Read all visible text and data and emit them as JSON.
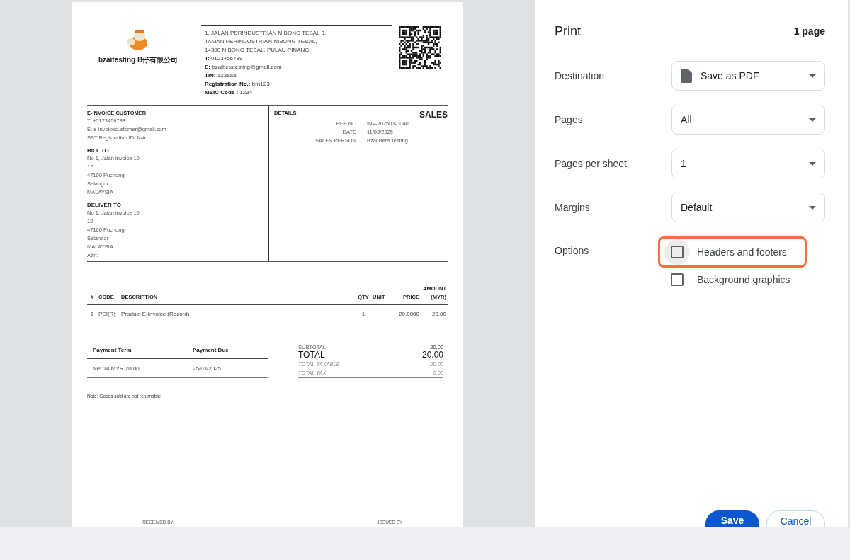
{
  "invoice": {
    "company_name": "bzaitesting B仔有限公司",
    "address_lines": [
      "1, JALAN PERINDUSTRIAN NIBONG TEBAL 3,",
      "TAMAN PERINDUSTRIAN NIBONG TEBAL,",
      "14300 NIBONG TEBAL, PULAU PINANG."
    ],
    "contact_lines": [
      "**T:** 0123456789",
      "**E:** bzaibetatesting@gmail.com",
      "**TIN:** 123aaa",
      "**Registration No.:** brn123",
      "**MSIC Code :** 1234"
    ],
    "customer": {
      "title": "E-INVOICE CUSTOMER",
      "lines": [
        "T: +0123456788",
        "E: e-invoicecustomer@gmail.com",
        "SST Registration ID: N/A"
      ]
    },
    "bill_to": {
      "title": "BILL TO",
      "lines": [
        "No 1, Jalan invoice 10",
        "12",
        "47100 Puchong",
        "Selangor",
        "MALAYSIA"
      ]
    },
    "deliver_to": {
      "title": "DELIVER TO",
      "lines": [
        "No 1, Jalan invoice 10",
        "12",
        "47100 Puchong",
        "Selangor",
        "MALAYSIA",
        "Attn:"
      ]
    },
    "details": {
      "title": "DETAILS",
      "document_type": "SALES",
      "rows": [
        {
          "label": "REF NO",
          "value": "INV-202503-0040"
        },
        {
          "label": "DATE",
          "value": "11/03/2025"
        },
        {
          "label": "SALES PERSON",
          "value": "Bzai Beta Testing"
        }
      ]
    },
    "items": {
      "columns": [
        "#",
        "CODE",
        "DESCRIPTION",
        "QTY",
        "UNIT",
        "PRICE",
        "AMOUNT (MYR)"
      ],
      "rows": [
        {
          "number": "1",
          "code": "PEI(R)",
          "description": "Product E-Invoice (Record)",
          "qty": "1",
          "price": "20.0000",
          "amount": "20.00"
        }
      ]
    },
    "payment": {
      "columns": [
        "Payment Term",
        "Payment Due"
      ],
      "rows": [
        [
          "Net 14 MYR 20.00",
          "25/03/2025"
        ]
      ]
    },
    "totals": [
      {
        "kind": "subtotal",
        "label": "SUBTOTAL",
        "value": "20.00"
      },
      {
        "kind": "total",
        "label": "TOTAL",
        "value": "20.00"
      },
      {
        "kind": "tax",
        "label": "TOTAL TAXABLE",
        "value": "20.00"
      },
      {
        "kind": "tax",
        "label": "TOTAL TAX",
        "value": "0.00"
      }
    ],
    "note": "Note: Goods sold are not returnable!",
    "signatures": [
      "RECEIVED BY",
      "ISSUED BY"
    ]
  },
  "print": {
    "title": "Print",
    "page_count": "1 page",
    "settings": [
      {
        "label": "Destination",
        "kind": "destination",
        "value": "Save as PDF"
      },
      {
        "label": "Pages",
        "kind": "select",
        "value": "All"
      },
      {
        "label": "Pages per sheet",
        "kind": "select",
        "value": "1"
      },
      {
        "label": "Margins",
        "kind": "select",
        "value": "Default"
      }
    ],
    "options_label": "Options",
    "options": [
      {
        "label": "Headers and footers",
        "checked": false,
        "highlighted": true
      },
      {
        "label": "Background graphics",
        "checked": false,
        "highlighted": false
      }
    ],
    "buttons": [
      {
        "label": "Save",
        "kind": "primary"
      },
      {
        "label": "Cancel",
        "kind": "secondary"
      }
    ]
  }
}
